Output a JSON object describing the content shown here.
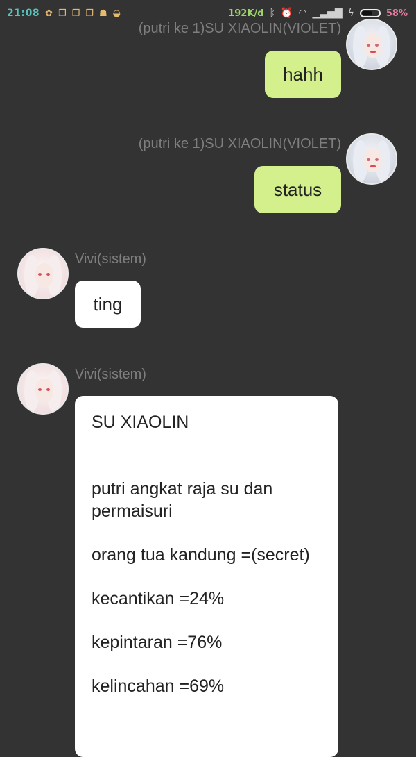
{
  "status_bar": {
    "time": "21:08",
    "network_speed": "192K/d",
    "battery_percent": "58%",
    "battery_level": 0.58
  },
  "messages": [
    {
      "sender": "(putri ke 1)SU XIAOLIN(VIOLET)",
      "text": "hahh",
      "direction": "sent"
    },
    {
      "sender": "(putri ke 1)SU XIAOLIN(VIOLET)",
      "text": "status",
      "direction": "sent"
    },
    {
      "sender": "Vivi(sistem)",
      "text": "ting",
      "direction": "received"
    },
    {
      "sender": "Vivi(sistem)",
      "direction": "received",
      "lines": [
        "SU XIAOLIN",
        "putri angkat raja su dan permaisuri",
        "orang tua kandung =(secret)",
        "kecantikan =24%",
        "kepintaran =76%",
        "kelincahan =69%"
      ]
    }
  ],
  "colors": {
    "background": "#333333",
    "sent_bubble": "#d4f08c",
    "received_bubble": "#ffffff",
    "name_text": "#7f7f7f"
  }
}
